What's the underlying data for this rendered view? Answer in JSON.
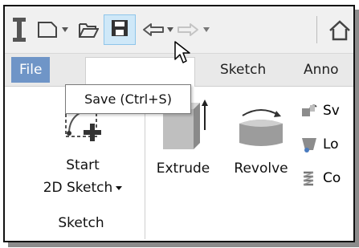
{
  "qat": {
    "icons": [
      "text-cursor-icon",
      "new-icon",
      "open-icon",
      "save-icon",
      "undo-icon",
      "redo-icon",
      "home-icon"
    ]
  },
  "tabs": {
    "file": "File",
    "sketch": "Sketch",
    "annotate": "Anno"
  },
  "ribbon": {
    "start_sketch_line1": "Start",
    "start_sketch_line2": "2D Sketch",
    "extrude": "Extrude",
    "revolve": "Revolve",
    "panel_label": "Sketch",
    "small_tool_1": "Sv",
    "small_tool_2": "Lo",
    "small_tool_3": "Co"
  },
  "tooltip": {
    "text": "Save (Ctrl+S)"
  },
  "colors": {
    "file_tab": "#6f95c7",
    "save_highlight": "#cfe8f8",
    "icon_gray": "#555555"
  }
}
